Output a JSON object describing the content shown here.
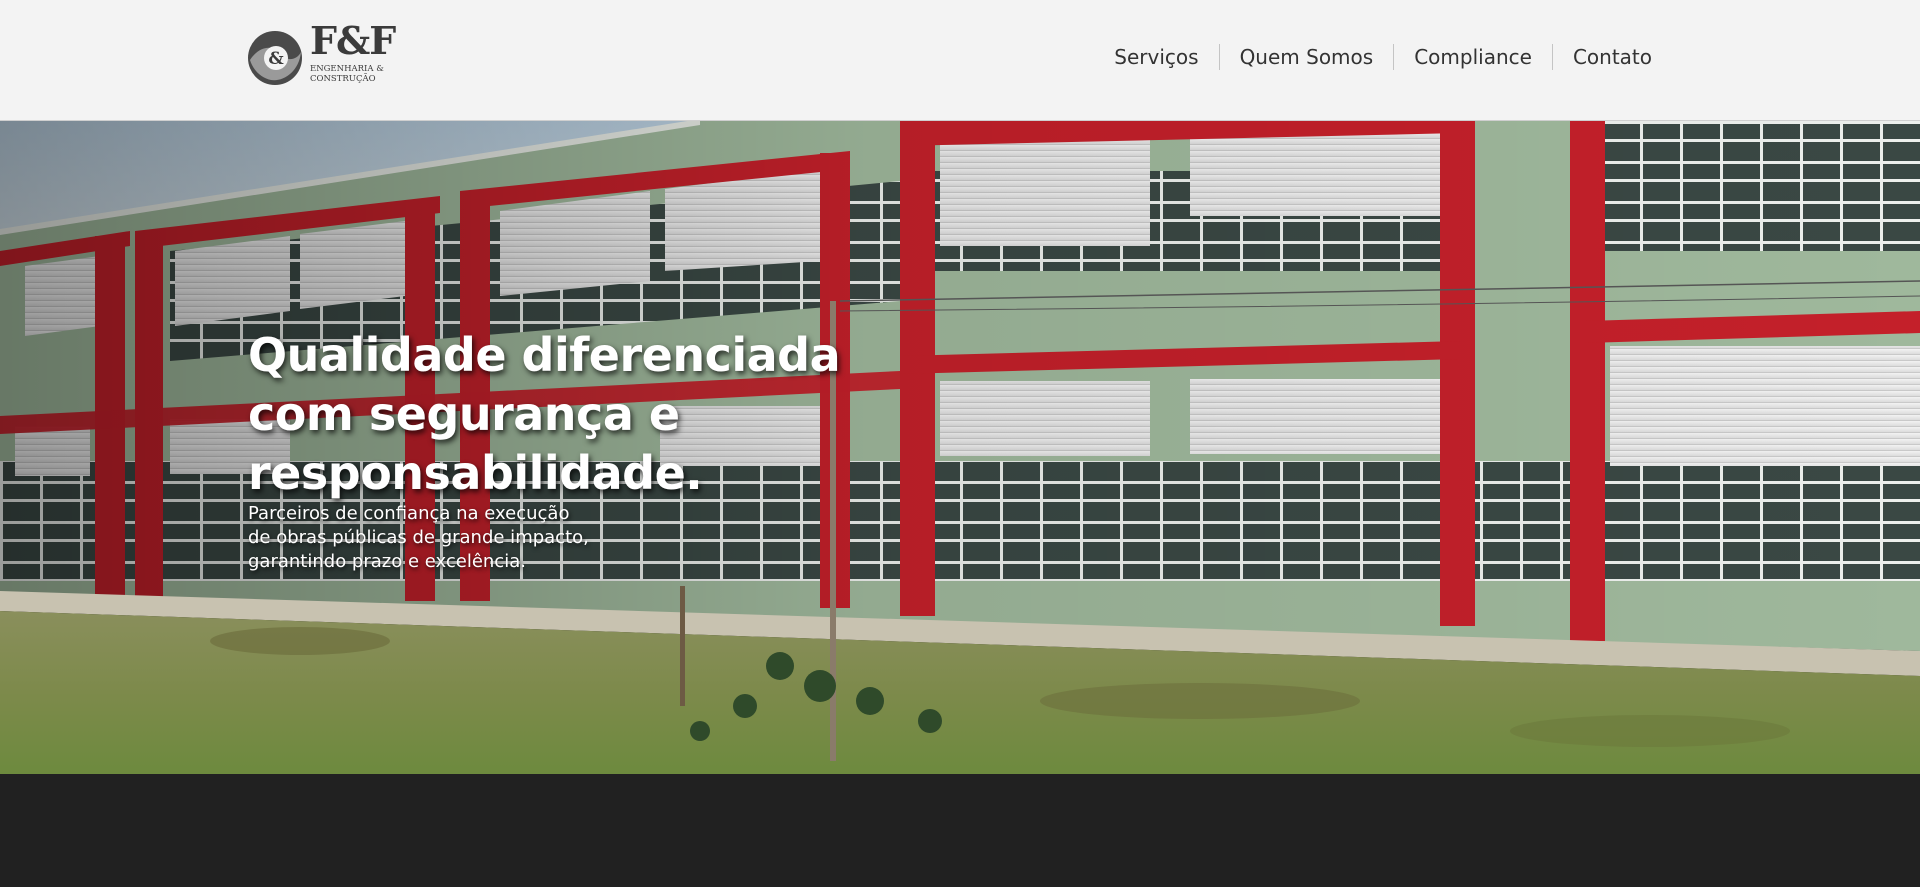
{
  "header": {
    "logo": {
      "brand": "F&F",
      "mark": "&",
      "line1": "ENGENHARIA &",
      "line2": "CONSTRUÇÃO"
    },
    "nav": [
      {
        "label": "Serviços"
      },
      {
        "label": "Quem Somos"
      },
      {
        "label": "Compliance"
      },
      {
        "label": "Contato"
      }
    ]
  },
  "hero": {
    "title": "Qualidade diferenciada\ncom segurança e\nresponsabilidade.",
    "subtitle": "Parceiros de confiança na execução\nde obras públicas de grande impacto,\ngarantindo prazo e excelência.",
    "image": "school-building-photo"
  },
  "colors": {
    "header_bg": "#f3f3f3",
    "accent_red": "#c4202a",
    "wall_green": "#9fb89c",
    "footer_bg": "#212121"
  }
}
